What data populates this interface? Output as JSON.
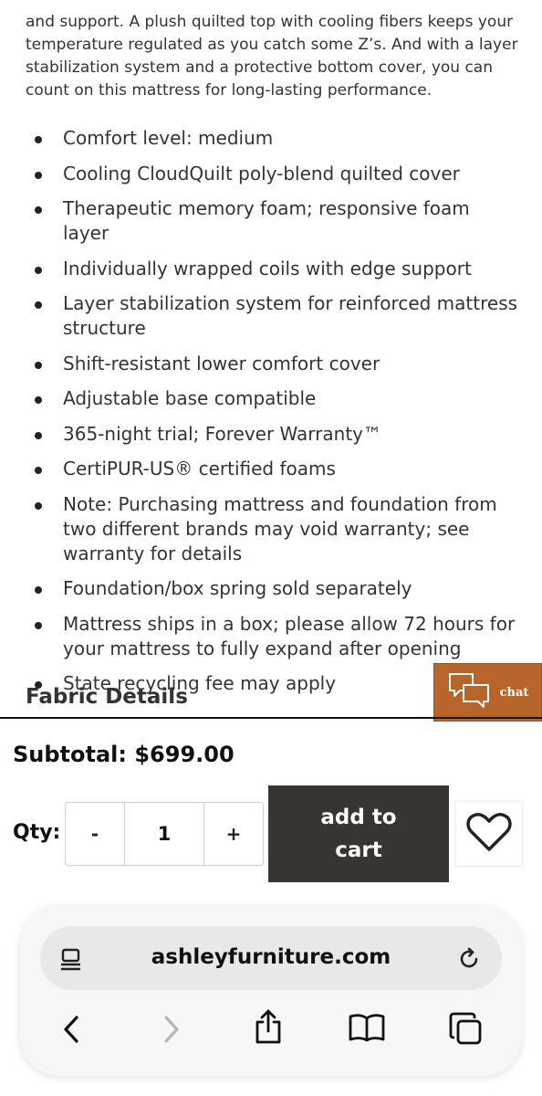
{
  "product": {
    "intro_text": "and support. A plush quilted top with cooling fibers keeps your temperature regulated as you catch some Z’s. And with a layer stabilization system and a protective bottom cover, you can count on this mattress for long-lasting performance.",
    "features": [
      "Comfort level: medium",
      "Cooling CloudQuilt poly-blend quilted cover",
      "Therapeutic memory foam; responsive foam layer",
      "Individually wrapped coils with edge support",
      "Layer stabilization system for reinforced mattress structure",
      "Shift-resistant lower comfort cover",
      "Adjustable base compatible",
      "365-night trial; Forever Warranty™",
      "CertiPUR-US® certified foams",
      "Note: Purchasing mattress and foundation from two different brands may void warranty; see warranty for details",
      "Foundation/box spring sold separately",
      "Mattress ships in a box; please allow 72 hours for your mattress to fully expand after opening",
      "State recycling fee may apply"
    ],
    "fabric_heading": "Fabric Details"
  },
  "chat": {
    "label": "chat",
    "icon": "chat-bubbles-icon",
    "color": "#b8652c"
  },
  "purchase": {
    "subtotal": "Subtotal: $699.00",
    "qty_label": "Qty:",
    "decrement": "-",
    "quantity": "1",
    "increment": "+",
    "add_to_cart": "add to cart",
    "wishlist_icon": "heart-icon",
    "button_color": "#383431"
  },
  "browser": {
    "url": "ashleyfurniture.com",
    "icons": [
      "page-menu-icon",
      "reload-icon",
      "back-icon",
      "forward-icon",
      "share-icon",
      "bookmarks-icon",
      "tabs-icon"
    ]
  }
}
